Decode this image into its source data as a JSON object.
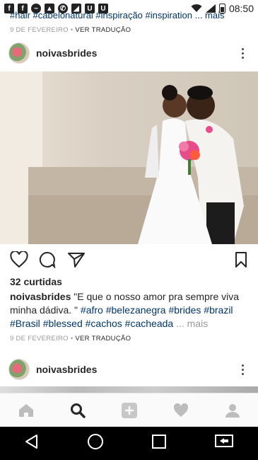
{
  "status_bar": {
    "time": "08:50",
    "icons": [
      "facebook-icon",
      "facebook-icon",
      "messenger-icon",
      "gallery-icon",
      "whatsapp-icon",
      "drive-icon",
      "notification-icon",
      "notification-icon"
    ]
  },
  "previous_post": {
    "tags_line": "#hair #cabelonatural #inspiração #inspiration ... mais",
    "date": "9 DE FEVEREIRO",
    "separator": "•",
    "translate": "VER TRADUÇÃO"
  },
  "post": {
    "username": "noivasbrides",
    "likes": "32 curtidas",
    "caption_user": "noivasbrides",
    "caption_text": " \"E que o nosso amor pra sempre viva minha dádiva. \" ",
    "hashtags": [
      "#afro",
      "#belezanegra",
      "#brides",
      "#brazil",
      "#Brasil",
      "#blessed",
      "#cachos",
      "#cacheada"
    ],
    "more": "... mais",
    "date": "9 DE FEVEREIRO",
    "separator": "•",
    "translate": "VER TRADUÇÃO"
  },
  "next_post": {
    "username": "noivasbrides"
  },
  "tab_bar": {
    "items": [
      "home-icon",
      "search-icon",
      "add-icon",
      "heart-icon",
      "profile-icon"
    ]
  },
  "nav_bar": {
    "items": [
      "back-icon",
      "home-icon",
      "recents-icon",
      "screen-mirror-icon"
    ]
  },
  "colors": {
    "hashtag": "#003569",
    "meta": "#999999",
    "text": "#262626"
  }
}
